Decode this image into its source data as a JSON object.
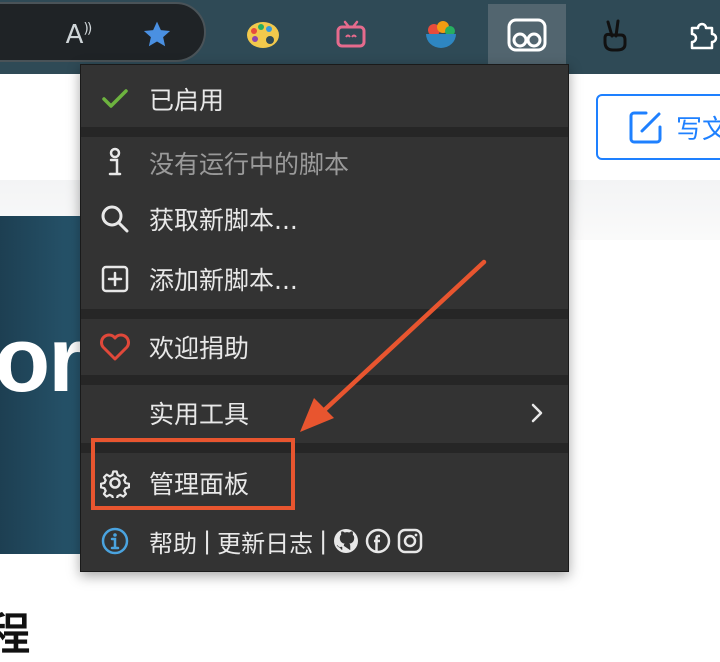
{
  "toolbar": {
    "read_aloud_letter": "A",
    "read_aloud_waves": "))",
    "icons": [
      "read-aloud-icon",
      "favorite-star-icon",
      "palette-icon",
      "tv-icon",
      "food-bowl-icon",
      "tampermonkey-icon",
      "peace-hand-icon",
      "puzzle-icon"
    ]
  },
  "page": {
    "write_button_label": "写文",
    "banner_text": "or",
    "bottom_heading": "程"
  },
  "menu": {
    "enabled_label": "已启用",
    "no_scripts_label": "没有运行中的脚本",
    "get_new_scripts_label": "获取新脚本...",
    "add_new_script_label": "添加新脚本...",
    "donate_label": "欢迎捐助",
    "utilities_label": "实用工具",
    "dashboard_label": "管理面板",
    "footer": {
      "help": "帮助",
      "sep1": "|",
      "changelog": "更新日志",
      "sep2": "|"
    }
  },
  "colors": {
    "toolbar_bg": "#2f4a56",
    "menu_bg": "#333333",
    "accent_blue": "#1e80ff",
    "annotation_red": "#e8552f",
    "check_green": "#6db33f",
    "heart_red": "#e0483a"
  }
}
